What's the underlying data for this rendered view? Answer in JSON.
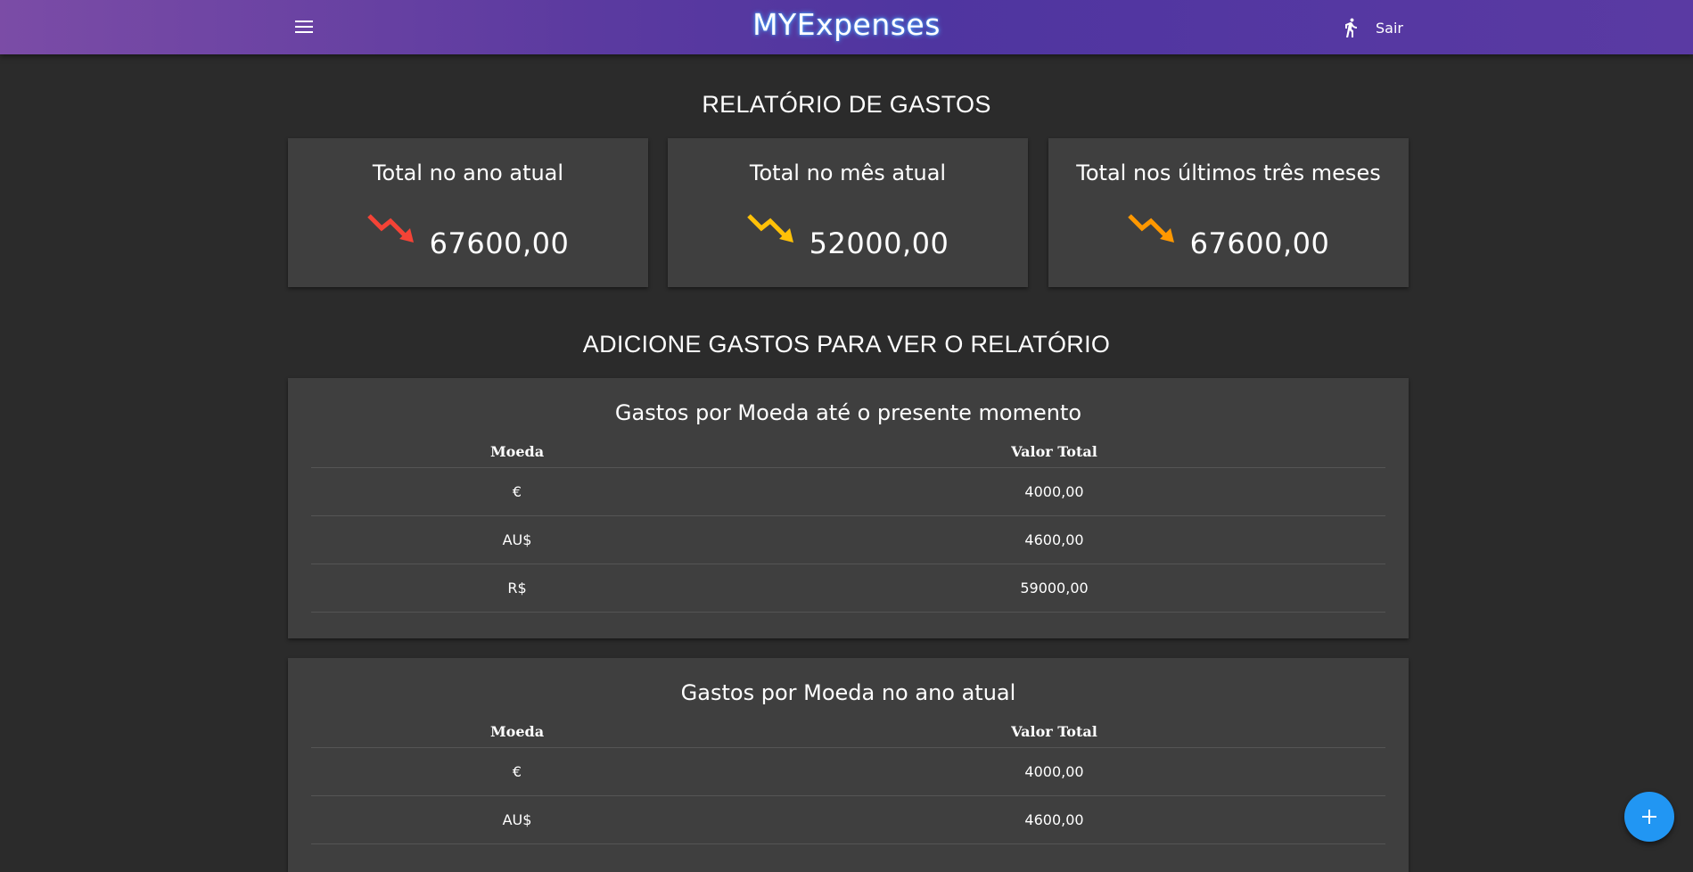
{
  "header": {
    "title": "MYExpenses",
    "logout_label": "Sair",
    "menu_icon": "menu-icon",
    "logout_icon": "walking-person-icon"
  },
  "report": {
    "heading": "RELATÓRIO DE GASTOS",
    "cards": [
      {
        "title": "Total no ano atual",
        "value": "67600,00",
        "trend_icon": "trending-down-icon",
        "color": "#f44336"
      },
      {
        "title": "Total no mês atual",
        "value": "52000,00",
        "trend_icon": "trending-down-icon",
        "color": "#ffc107"
      },
      {
        "title": "Total nos últimos três meses",
        "value": "67600,00",
        "trend_icon": "trending-down-icon",
        "color": "#ff9800"
      }
    ]
  },
  "add_heading": "ADICIONE GASTOS PARA VER O RELATÓRIO",
  "tables": [
    {
      "title": "Gastos por Moeda até o presente momento",
      "headers": [
        "Moeda",
        "Valor Total"
      ],
      "rows": [
        [
          "€",
          "4000,00"
        ],
        [
          "AU$",
          "4600,00"
        ],
        [
          "R$",
          "59000,00"
        ]
      ]
    },
    {
      "title": "Gastos por Moeda no ano atual",
      "headers": [
        "Moeda",
        "Valor Total"
      ],
      "rows": [
        [
          "€",
          "4000,00"
        ],
        [
          "AU$",
          "4600,00"
        ]
      ]
    }
  ],
  "fab": {
    "icon": "plus-icon",
    "accent": "#2196f3"
  }
}
